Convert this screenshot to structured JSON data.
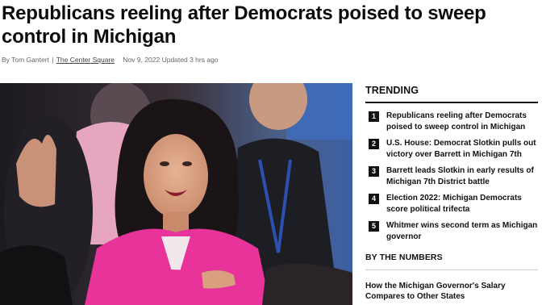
{
  "article": {
    "headline": "Republicans reeling after Democrats poised to sweep control in Michigan",
    "byline_prefix": "By Tom Gantert",
    "byline_sep": "|",
    "source": "The Center Square",
    "date": "Nov 9, 2022 Updated 3 hrs ago"
  },
  "sidebar": {
    "trending_title": "TRENDING",
    "trending": [
      {
        "num": "1",
        "text": "Republicans reeling after Democrats poised to sweep control in Michigan"
      },
      {
        "num": "2",
        "text": "U.S. House: Democrat Slotkin pulls out victory over Barrett in Michigan 7th"
      },
      {
        "num": "3",
        "text": "Barrett leads Slotkin in early results of Michigan 7th District battle"
      },
      {
        "num": "4",
        "text": "Election 2022: Michigan Democrats score political trifecta"
      },
      {
        "num": "5",
        "text": "Whitmer wins second term as Michigan governor"
      }
    ],
    "numbers_title": "BY THE NUMBERS",
    "numbers_item": "How the Michigan Governor's Salary Compares to Other States"
  },
  "colors": {
    "accent": "#111111",
    "jacket": "#e8339a",
    "byline": "#666666"
  }
}
